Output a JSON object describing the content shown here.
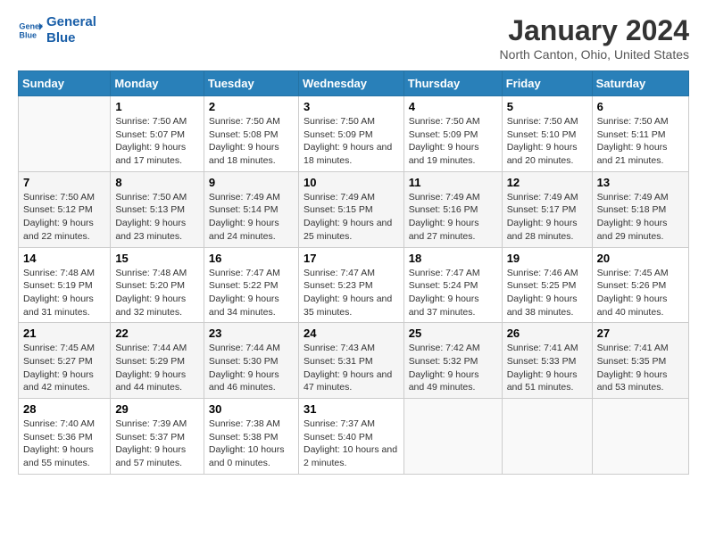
{
  "logo": {
    "line1": "General",
    "line2": "Blue"
  },
  "title": "January 2024",
  "location": "North Canton, Ohio, United States",
  "days_of_week": [
    "Sunday",
    "Monday",
    "Tuesday",
    "Wednesday",
    "Thursday",
    "Friday",
    "Saturday"
  ],
  "weeks": [
    [
      {
        "day": "",
        "sunrise": "",
        "sunset": "",
        "daylight": ""
      },
      {
        "day": "1",
        "sunrise": "Sunrise: 7:50 AM",
        "sunset": "Sunset: 5:07 PM",
        "daylight": "Daylight: 9 hours and 17 minutes."
      },
      {
        "day": "2",
        "sunrise": "Sunrise: 7:50 AM",
        "sunset": "Sunset: 5:08 PM",
        "daylight": "Daylight: 9 hours and 18 minutes."
      },
      {
        "day": "3",
        "sunrise": "Sunrise: 7:50 AM",
        "sunset": "Sunset: 5:09 PM",
        "daylight": "Daylight: 9 hours and 18 minutes."
      },
      {
        "day": "4",
        "sunrise": "Sunrise: 7:50 AM",
        "sunset": "Sunset: 5:09 PM",
        "daylight": "Daylight: 9 hours and 19 minutes."
      },
      {
        "day": "5",
        "sunrise": "Sunrise: 7:50 AM",
        "sunset": "Sunset: 5:10 PM",
        "daylight": "Daylight: 9 hours and 20 minutes."
      },
      {
        "day": "6",
        "sunrise": "Sunrise: 7:50 AM",
        "sunset": "Sunset: 5:11 PM",
        "daylight": "Daylight: 9 hours and 21 minutes."
      }
    ],
    [
      {
        "day": "7",
        "sunrise": "Sunrise: 7:50 AM",
        "sunset": "Sunset: 5:12 PM",
        "daylight": "Daylight: 9 hours and 22 minutes."
      },
      {
        "day": "8",
        "sunrise": "Sunrise: 7:50 AM",
        "sunset": "Sunset: 5:13 PM",
        "daylight": "Daylight: 9 hours and 23 minutes."
      },
      {
        "day": "9",
        "sunrise": "Sunrise: 7:49 AM",
        "sunset": "Sunset: 5:14 PM",
        "daylight": "Daylight: 9 hours and 24 minutes."
      },
      {
        "day": "10",
        "sunrise": "Sunrise: 7:49 AM",
        "sunset": "Sunset: 5:15 PM",
        "daylight": "Daylight: 9 hours and 25 minutes."
      },
      {
        "day": "11",
        "sunrise": "Sunrise: 7:49 AM",
        "sunset": "Sunset: 5:16 PM",
        "daylight": "Daylight: 9 hours and 27 minutes."
      },
      {
        "day": "12",
        "sunrise": "Sunrise: 7:49 AM",
        "sunset": "Sunset: 5:17 PM",
        "daylight": "Daylight: 9 hours and 28 minutes."
      },
      {
        "day": "13",
        "sunrise": "Sunrise: 7:49 AM",
        "sunset": "Sunset: 5:18 PM",
        "daylight": "Daylight: 9 hours and 29 minutes."
      }
    ],
    [
      {
        "day": "14",
        "sunrise": "Sunrise: 7:48 AM",
        "sunset": "Sunset: 5:19 PM",
        "daylight": "Daylight: 9 hours and 31 minutes."
      },
      {
        "day": "15",
        "sunrise": "Sunrise: 7:48 AM",
        "sunset": "Sunset: 5:20 PM",
        "daylight": "Daylight: 9 hours and 32 minutes."
      },
      {
        "day": "16",
        "sunrise": "Sunrise: 7:47 AM",
        "sunset": "Sunset: 5:22 PM",
        "daylight": "Daylight: 9 hours and 34 minutes."
      },
      {
        "day": "17",
        "sunrise": "Sunrise: 7:47 AM",
        "sunset": "Sunset: 5:23 PM",
        "daylight": "Daylight: 9 hours and 35 minutes."
      },
      {
        "day": "18",
        "sunrise": "Sunrise: 7:47 AM",
        "sunset": "Sunset: 5:24 PM",
        "daylight": "Daylight: 9 hours and 37 minutes."
      },
      {
        "day": "19",
        "sunrise": "Sunrise: 7:46 AM",
        "sunset": "Sunset: 5:25 PM",
        "daylight": "Daylight: 9 hours and 38 minutes."
      },
      {
        "day": "20",
        "sunrise": "Sunrise: 7:45 AM",
        "sunset": "Sunset: 5:26 PM",
        "daylight": "Daylight: 9 hours and 40 minutes."
      }
    ],
    [
      {
        "day": "21",
        "sunrise": "Sunrise: 7:45 AM",
        "sunset": "Sunset: 5:27 PM",
        "daylight": "Daylight: 9 hours and 42 minutes."
      },
      {
        "day": "22",
        "sunrise": "Sunrise: 7:44 AM",
        "sunset": "Sunset: 5:29 PM",
        "daylight": "Daylight: 9 hours and 44 minutes."
      },
      {
        "day": "23",
        "sunrise": "Sunrise: 7:44 AM",
        "sunset": "Sunset: 5:30 PM",
        "daylight": "Daylight: 9 hours and 46 minutes."
      },
      {
        "day": "24",
        "sunrise": "Sunrise: 7:43 AM",
        "sunset": "Sunset: 5:31 PM",
        "daylight": "Daylight: 9 hours and 47 minutes."
      },
      {
        "day": "25",
        "sunrise": "Sunrise: 7:42 AM",
        "sunset": "Sunset: 5:32 PM",
        "daylight": "Daylight: 9 hours and 49 minutes."
      },
      {
        "day": "26",
        "sunrise": "Sunrise: 7:41 AM",
        "sunset": "Sunset: 5:33 PM",
        "daylight": "Daylight: 9 hours and 51 minutes."
      },
      {
        "day": "27",
        "sunrise": "Sunrise: 7:41 AM",
        "sunset": "Sunset: 5:35 PM",
        "daylight": "Daylight: 9 hours and 53 minutes."
      }
    ],
    [
      {
        "day": "28",
        "sunrise": "Sunrise: 7:40 AM",
        "sunset": "Sunset: 5:36 PM",
        "daylight": "Daylight: 9 hours and 55 minutes."
      },
      {
        "day": "29",
        "sunrise": "Sunrise: 7:39 AM",
        "sunset": "Sunset: 5:37 PM",
        "daylight": "Daylight: 9 hours and 57 minutes."
      },
      {
        "day": "30",
        "sunrise": "Sunrise: 7:38 AM",
        "sunset": "Sunset: 5:38 PM",
        "daylight": "Daylight: 10 hours and 0 minutes."
      },
      {
        "day": "31",
        "sunrise": "Sunrise: 7:37 AM",
        "sunset": "Sunset: 5:40 PM",
        "daylight": "Daylight: 10 hours and 2 minutes."
      },
      {
        "day": "",
        "sunrise": "",
        "sunset": "",
        "daylight": ""
      },
      {
        "day": "",
        "sunrise": "",
        "sunset": "",
        "daylight": ""
      },
      {
        "day": "",
        "sunrise": "",
        "sunset": "",
        "daylight": ""
      }
    ]
  ]
}
